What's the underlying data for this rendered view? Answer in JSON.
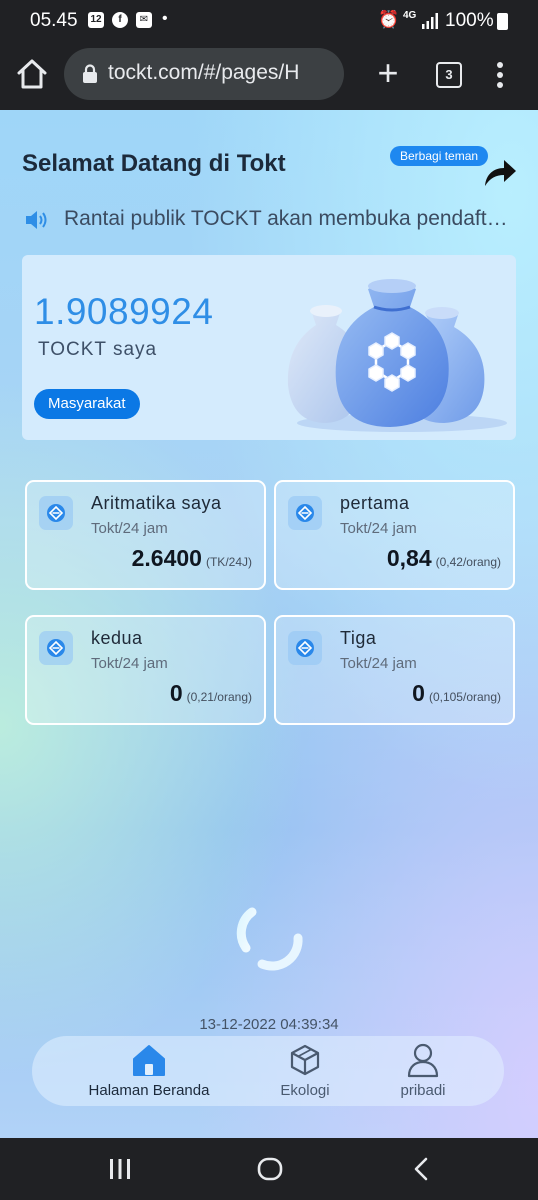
{
  "status_bar": {
    "time": "05.45",
    "calendar_badge": "12",
    "network": "4G",
    "battery": "100%"
  },
  "browser": {
    "url": "tockt.com/#/pages/H",
    "tab_count": "3"
  },
  "header": {
    "title": "Selamat Datang di Tokt",
    "share_label": "Berbagi teman"
  },
  "announcement": {
    "text": "Rantai publik TOCKT akan membuka pendaftaran untuk semua pengguna"
  },
  "balance": {
    "value": "1.9089924",
    "label": "TOCKT saya",
    "community_button": "Masyarakat"
  },
  "stats": [
    {
      "title": "Aritmatika saya",
      "unit": "Tokt/24 jam",
      "value": "2.6400",
      "sub": "(TK/24J)"
    },
    {
      "title": "pertama",
      "unit": "Tokt/24 jam",
      "value": "0,84",
      "sub": "(0,42/orang)"
    },
    {
      "title": "kedua",
      "unit": "Tokt/24 jam",
      "value": "0",
      "sub": "(0,21/orang)"
    },
    {
      "title": "Tiga",
      "unit": "Tokt/24 jam",
      "value": "0",
      "sub": "(0,105/orang)"
    }
  ],
  "timestamp": "13-12-2022 04:39:34",
  "bottom_nav": {
    "items": [
      {
        "label": "Halaman Beranda",
        "icon": "home-icon",
        "active": true
      },
      {
        "label": "Ekologi",
        "icon": "cube-icon",
        "active": false
      },
      {
        "label": "pribadi",
        "icon": "user-icon",
        "active": false
      }
    ]
  },
  "colors": {
    "accent": "#1e88f0",
    "balance_value": "#2f8ee6",
    "nav_active": "#1c2a3b",
    "nav_inactive": "#4a5a70"
  }
}
